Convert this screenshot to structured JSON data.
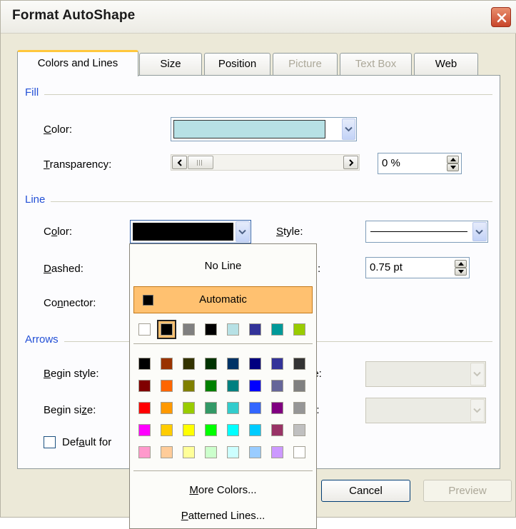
{
  "dialog": {
    "title": "Format AutoShape",
    "tabs": [
      {
        "label": "Colors and Lines",
        "state": "active"
      },
      {
        "label": "Size",
        "state": "normal"
      },
      {
        "label": "Position",
        "state": "normal"
      },
      {
        "label": "Picture",
        "state": "disabled"
      },
      {
        "label": "Text Box",
        "state": "disabled"
      },
      {
        "label": "Web",
        "state": "normal"
      }
    ]
  },
  "fill": {
    "group_label": "Fill",
    "color_label": "Color:",
    "color_value": "#b7e1e5",
    "transparency_label": "Transparency:",
    "transparency_value": "0 %"
  },
  "line": {
    "group_label": "Line",
    "color_label": "Color:",
    "color_value": "#000000",
    "style_label": "Style:",
    "dashed_label": "Dashed:",
    "weight_label": ":",
    "weight_value": "0.75 pt",
    "connector_label": "Connector:"
  },
  "arrows": {
    "group_label": "Arrows",
    "begin_style_label": "Begin style:",
    "begin_size_label": "Begin size:",
    "end_style_label": "le:",
    "end_size_label": "e:",
    "default_label": "Default for"
  },
  "buttons": {
    "cancel": "Cancel",
    "preview": "Preview"
  },
  "color_popup": {
    "no_line": "No Line",
    "automatic": "Automatic",
    "more_colors": "More Colors...",
    "patterned_lines": "Patterned Lines...",
    "recent_colors": [
      "#ffffff",
      "#000000",
      "#808080",
      "#000000",
      "#b7e1e5",
      "#333399",
      "#009999",
      "#99cc00"
    ],
    "selected_recent": 1,
    "standard_colors": [
      [
        "#000000",
        "#993300",
        "#333300",
        "#003300",
        "#003366",
        "#000080",
        "#333399",
        "#333333"
      ],
      [
        "#800000",
        "#ff6600",
        "#808000",
        "#008000",
        "#008080",
        "#0000ff",
        "#666699",
        "#808080"
      ],
      [
        "#ff0000",
        "#ff9900",
        "#99cc00",
        "#339966",
        "#33cccc",
        "#3366ff",
        "#800080",
        "#969696"
      ],
      [
        "#ff00ff",
        "#ffcc00",
        "#ffff00",
        "#00ff00",
        "#00ffff",
        "#00ccff",
        "#993366",
        "#c0c0c0"
      ],
      [
        "#ff99cc",
        "#ffcc99",
        "#ffff99",
        "#ccffcc",
        "#ccffff",
        "#99ccff",
        "#cc99ff",
        "#ffffff"
      ]
    ]
  },
  "colors": {
    "accent_tab": "#ffc73c",
    "group_title": "#2350d6",
    "highlight": "#ffc170"
  },
  "icons": {
    "close": "close-icon",
    "dropdown": "chevron-down-icon",
    "scroll_left": "arrow-left-icon",
    "scroll_right": "arrow-right-icon",
    "spin_up": "arrow-up-icon",
    "spin_down": "arrow-down-icon"
  }
}
